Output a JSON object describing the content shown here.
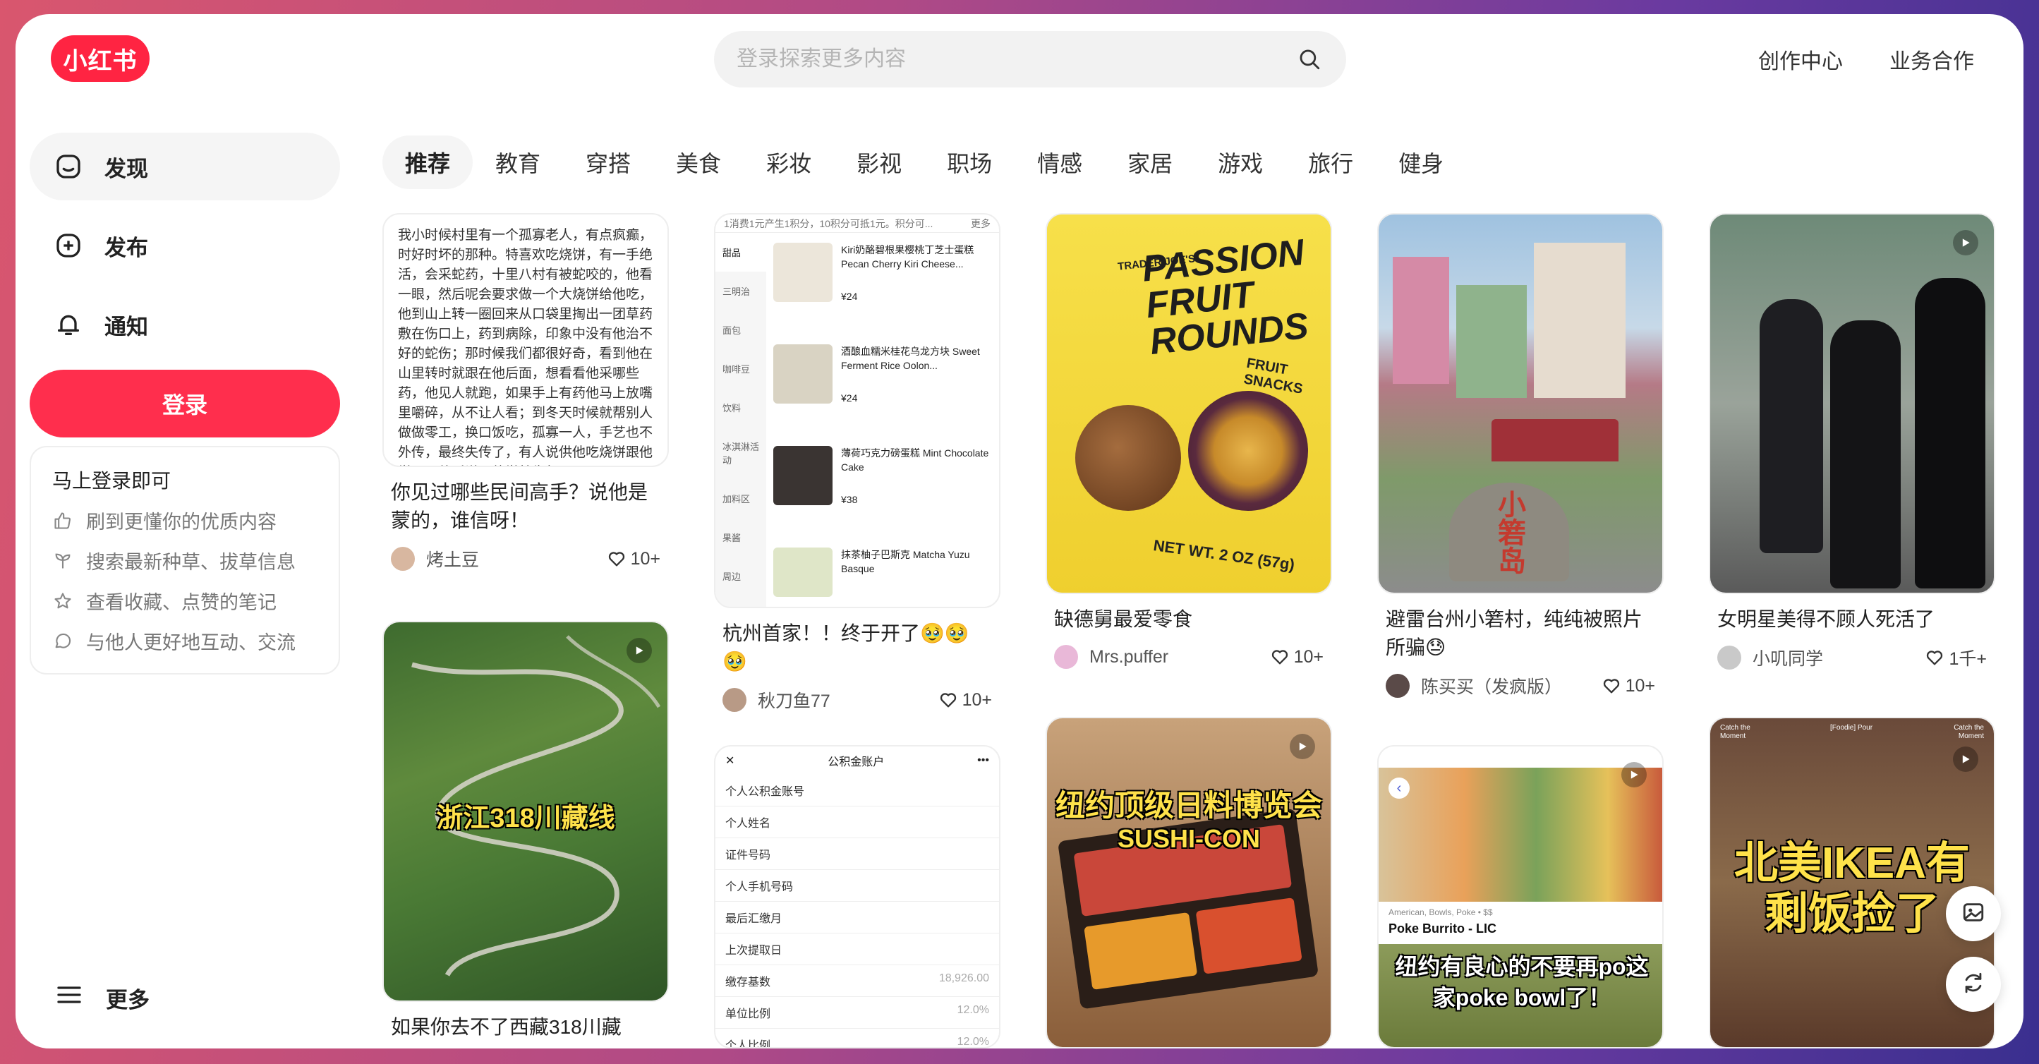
{
  "header": {
    "logo_text": "小红书",
    "search_placeholder": "登录探索更多内容",
    "links": [
      "创作中心",
      "业务合作"
    ]
  },
  "sidebar": {
    "items": [
      {
        "label": "发现",
        "icon": "home-icon",
        "active": true
      },
      {
        "label": "发布",
        "icon": "plus-square-icon",
        "active": false
      },
      {
        "label": "通知",
        "icon": "bell-icon",
        "active": false
      }
    ],
    "login_label": "登录",
    "login_card": {
      "title": "马上登录即可",
      "rows": [
        {
          "icon": "thumb-up-icon",
          "text": "刷到更懂你的优质内容"
        },
        {
          "icon": "sprout-icon",
          "text": "搜索最新种草、拔草信息"
        },
        {
          "icon": "star-icon",
          "text": "查看收藏、点赞的笔记"
        },
        {
          "icon": "chat-icon",
          "text": "与他人更好地互动、交流"
        }
      ]
    },
    "more_label": "更多"
  },
  "tabs": [
    "推荐",
    "教育",
    "穿搭",
    "美食",
    "彩妆",
    "影视",
    "职场",
    "情感",
    "家居",
    "游戏",
    "旅行",
    "健身"
  ],
  "feed": {
    "c1": {
      "note_text": "我小时候村里有一个孤寡老人，有点疯癫，时好时坏的那种。特喜欢吃烧饼，有一手绝活，会采蛇药，十里八村有被蛇咬的，他看一眼，然后呢会要求做一个大烧饼给他吃，他到山上转一圈回来从口袋里掏出一团草药敷在伤口上，药到病除，印象中没有他治不好的蛇伤；那时候我们都很好奇，看到他在山里转时就跟在他后面，想看看他采哪些药，他见人就跑，如果手上有药他马上放嘴里嚼碎，从不让人看；到冬天时候就帮别人做做零工，换口饭吃，孤寡一人，手艺也不外传，最终失传了，有人说供他吃烧饼跟他学习，他听说跟他学就生气",
      "title": "你见过哪些民间高手？说他是蒙的，谁信呀！",
      "author": "烤土豆",
      "likes": "10+"
    },
    "c2": {
      "overlay": "浙江318川藏线",
      "title": "如果你去不了西藏318川藏"
    },
    "c3": {
      "menu_header": "1消费1元产生1积分，10积分可抵1元。积分可...",
      "menu_more": "更多",
      "categories": [
        "甜品",
        "三明治",
        "面包",
        "咖啡豆",
        "饮料",
        "冰淇淋活动",
        "加料区",
        "果酱",
        "周边"
      ],
      "items": [
        {
          "name": "Kiri奶酪碧根果樱桃丁芝士蛋糕 Pecan Cherry Kiri Cheese...",
          "price": "¥24"
        },
        {
          "name": "酒酿血糯米桂花乌龙方块 Sweet Ferment Rice Oolon...",
          "price": "¥24"
        },
        {
          "name": "薄荷巧克力磅蛋糕 Mint Chocolate Cake",
          "price": "¥38"
        },
        {
          "name": "抹茶柚子巴斯克 Matcha Yuzu Basque",
          "price": ""
        }
      ],
      "title": "杭州首家！！终于开了🥹🥹🥹",
      "author": "秋刀鱼77",
      "likes": "10+"
    },
    "c4": {
      "header": "公积金账户",
      "rows": [
        "个人公积金账号",
        "个人姓名",
        "证件号码",
        "个人手机号码",
        "最后汇缴月",
        "上次提取日",
        "缴存基数",
        "单位比例",
        "个人比例"
      ],
      "values": [
        "",
        "",
        "",
        "",
        "",
        "",
        "18,926.00",
        "12.0%",
        "12.0%"
      ]
    },
    "c5": {
      "brand": "TRADER JOE'S",
      "product": "PASSION FRUIT ROUNDS",
      "sub": "FRUIT SNACKS",
      "weight": "NET WT. 2 OZ (57g)",
      "title": "缺德舅最爱零食",
      "author": "Mrs.puffer",
      "likes": "10+"
    },
    "c6": {
      "overlay1": "纽约顶级日料博览会",
      "overlay2": "SUSHI-CON"
    },
    "c7": {
      "sign": "小箬岛",
      "title": "避雷台州小箬村，纯纯被照片所骗😓",
      "author": "陈买买（发疯版）",
      "likes": "10+"
    },
    "c8": {
      "tags": "American, Bowls, Poke • $$",
      "shop": "Poke Burrito - LIC",
      "overlay": "纽约有良心的不要再po这家poke bowl了！"
    },
    "c9": {
      "title": "女明星美得不顾人死活了",
      "author": "小叽同学",
      "likes": "1千+"
    },
    "c10": {
      "overlay": "北美IKEA有剩饭捡了",
      "corner_left": "Catch the Moment",
      "corner_mid": "[Foodie] Pour",
      "corner_right": "Catch the Moment"
    }
  },
  "colors": {
    "brand": "#ff2442",
    "login": "#ff2e4d"
  }
}
